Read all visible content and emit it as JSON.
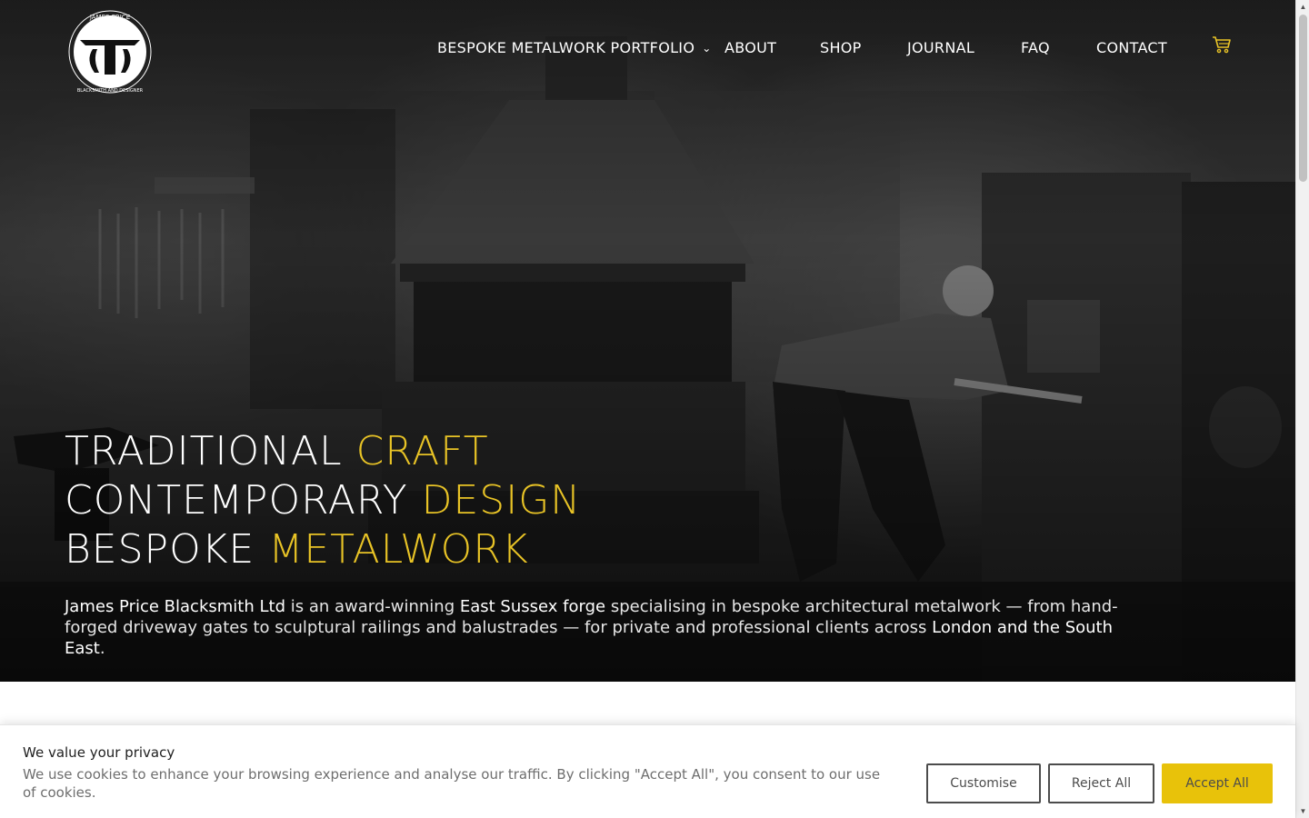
{
  "brand": {
    "logo_top": "JAMES PRICE",
    "logo_bottom": "BLACKSMITH AND DESIGNER"
  },
  "nav": {
    "portfolio": "BESPOKE METALWORK PORTFOLIO",
    "about": "ABOUT",
    "shop": "SHOP",
    "journal": "JOURNAL",
    "faq": "FAQ",
    "contact": "CONTACT",
    "cart_icon": "shopping-cart-icon",
    "chevron_icon": "chevron-down-icon"
  },
  "hero": {
    "line1_white": "TRADITIONAL",
    "line1_accent": "CRAFT",
    "line2_white": "CONTEMPORARY",
    "line2_accent": "DESIGN",
    "line3_white": "BESPOKE",
    "line3_accent": "METALWORK",
    "intro": {
      "company": "James Price Blacksmith Ltd",
      "t1": " is an award-winning ",
      "forge": "East Sussex forge",
      "t2": " specialising in bespoke architectural metalwork — from hand-forged driveway gates to sculptural railings and balustrades — for private and professional clients across ",
      "region": "London and the South East",
      "t3": "."
    }
  },
  "cookie": {
    "title": "We value your privacy",
    "text": "We use cookies to enhance your browsing experience and analyse our traffic. By clicking \"Accept All\", you consent to our use of cookies.",
    "customise": "Customise",
    "reject": "Reject All",
    "accept": "Accept All"
  },
  "colors": {
    "accent": "#e8c326",
    "accept_button": "#e8c20a",
    "button_border": "#4c4c4c"
  }
}
